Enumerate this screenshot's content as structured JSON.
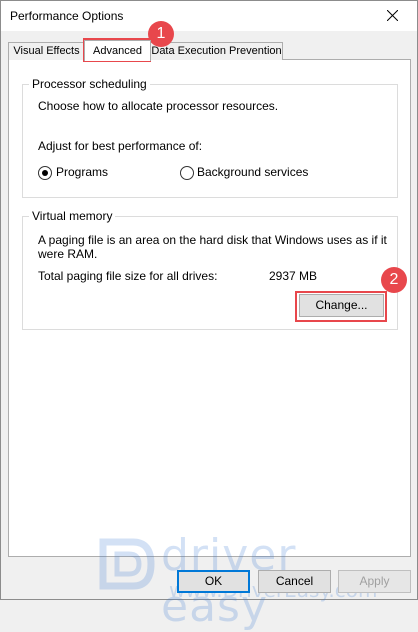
{
  "window": {
    "title": "Performance Options"
  },
  "tabs": [
    {
      "label": "Visual Effects"
    },
    {
      "label": "Advanced"
    },
    {
      "label": "Data Execution Prevention"
    }
  ],
  "processor_scheduling": {
    "legend": "Processor scheduling",
    "description": "Choose how to allocate processor resources.",
    "adjust_label": "Adjust for best performance of:",
    "options": [
      {
        "label": "Programs",
        "checked": true
      },
      {
        "label": "Background services",
        "checked": false
      }
    ]
  },
  "virtual_memory": {
    "legend": "Virtual memory",
    "description_line1": "A paging file is an area on the hard disk that Windows uses as if it",
    "description_line2": "were RAM.",
    "total_label": "Total paging file size for all drives:",
    "total_value": "2937 MB",
    "change_button": "Change..."
  },
  "footer": {
    "ok": "OK",
    "cancel": "Cancel",
    "apply": "Apply"
  },
  "annotations": [
    {
      "number": "1",
      "color": "#e8474c"
    },
    {
      "number": "2",
      "color": "#e8474c"
    }
  ],
  "watermark": {
    "brand": "driver easy",
    "url": "www.DriverEasy.com"
  }
}
